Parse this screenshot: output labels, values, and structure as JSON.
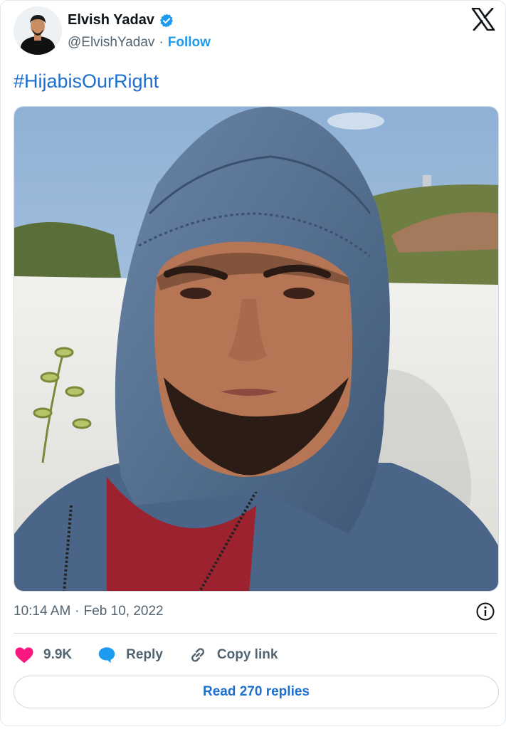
{
  "author": {
    "display_name": "Elvish Yadav",
    "handle": "@ElvishYadav",
    "separator": "·",
    "follow_label": "Follow",
    "verified": true
  },
  "tweet": {
    "text": "#HijabisOurRight",
    "time": "10:14 AM",
    "separator": "·",
    "date": "Feb 10, 2022"
  },
  "actions": {
    "likes": "9.9K",
    "reply_label": "Reply",
    "copy_link_label": "Copy link"
  },
  "read_replies_label": "Read 270 replies",
  "icons": {
    "like": "heart-icon",
    "reply": "speech-bubble-icon",
    "copy": "link-icon",
    "brand": "x-logo-icon",
    "info": "info-icon",
    "verified": "verified-badge-icon"
  },
  "colors": {
    "accent": "#1d9bf0",
    "link": "#1d6fd0",
    "heart": "#f91880",
    "muted": "#536471"
  }
}
